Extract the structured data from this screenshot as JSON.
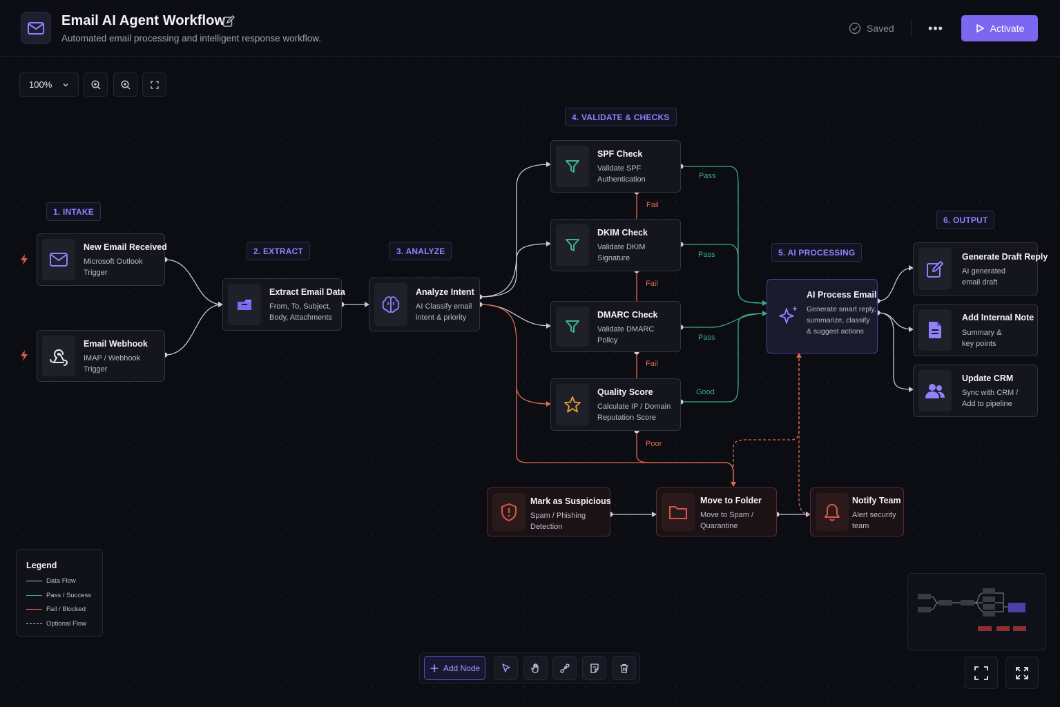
{
  "header": {
    "title": "Email AI Agent Workflow",
    "subtitle": "Automated email processing and intelligent response workflow.",
    "saved_label": "Saved",
    "more_label": "•••",
    "activate_label": "Activate"
  },
  "toolbar": {
    "zoom_value": "100%"
  },
  "sections": {
    "intake": "1. INTAKE",
    "extract": "2. EXTRACT",
    "analyze": "3. ANALYZE",
    "validate": "4. VALIDATE & CHECKS",
    "ai_processing": "5. AI PROCESSING",
    "output": "6. OUTPUT"
  },
  "nodes": {
    "new_email": {
      "title": "New Email Received",
      "desc": "Microsoft Outlook\nTrigger",
      "icon": "mail-icon"
    },
    "webhook": {
      "title": "Email Webhook",
      "desc": "IMAP / Webhook\nTrigger",
      "icon": "webhook-icon"
    },
    "extract": {
      "title": "Extract Email Data",
      "desc": "From, To, Subject,\nBody, Attachments",
      "icon": "box-icon"
    },
    "analyze": {
      "title": "Analyze Intent",
      "desc": "AI Classify email\nintent & priority",
      "icon": "brain-icon"
    },
    "spf": {
      "title": "SPF Check",
      "desc": "Validate SPF\nAuthentication",
      "icon": "filter-icon"
    },
    "dkim": {
      "title": "DKIM Check",
      "desc": "Validate DKIM\nSignature",
      "icon": "filter-icon"
    },
    "dmarc": {
      "title": "DMARC Check",
      "desc": "Validate DMARC\nPolicy",
      "icon": "filter-icon"
    },
    "quality": {
      "title": "Quality Score",
      "desc": "Calculate IP / Domain\nReputation Score",
      "icon": "star-icon"
    },
    "ai_process": {
      "title": "AI Process Email",
      "desc": "Generate smart reply,\nsummarize, classify\n& suggest actions",
      "icon": "sparkle-icon"
    },
    "draft_reply": {
      "title": "Generate Draft Reply",
      "desc": "AI generated\nemail draft",
      "icon": "pencil-icon"
    },
    "internal_note": {
      "title": "Add Internal Note",
      "desc": "Summary &\nkey points",
      "icon": "document-icon"
    },
    "update_crm": {
      "title": "Update CRM",
      "desc": "Sync with CRM /\nAdd to pipeline",
      "icon": "users-icon"
    },
    "mark_suspicious": {
      "title": "Mark as Suspicious",
      "desc": "Spam / Phishing\nDetection",
      "icon": "shield-alert-icon"
    },
    "move_folder": {
      "title": "Move to Folder",
      "desc": "Move to Spam /\nQuarantine",
      "icon": "folder-icon"
    },
    "notify_team": {
      "title": "Notify Team",
      "desc": "Alert security\nteam",
      "icon": "bell-icon"
    }
  },
  "edge_labels": {
    "spf_pass": "Pass",
    "spf_fail": "Fail",
    "dkim_pass": "Pass",
    "dkim_fail": "Fail",
    "dmarc_pass": "Pass",
    "dmarc_fail": "Fail",
    "quality_good": "Good",
    "quality_poor": "Poor"
  },
  "legend": {
    "title": "Legend",
    "items": [
      {
        "label": "Data Flow",
        "color": "#c9c9d6",
        "style": "solid"
      },
      {
        "label": "Pass / Success",
        "color": "#3fa889",
        "style": "solid"
      },
      {
        "label": "Fail / Blocked",
        "color": "#e06a4e",
        "style": "solid"
      },
      {
        "label": "Optional Flow",
        "color": "#c9c9d6",
        "style": "dashed"
      }
    ]
  },
  "bottom_toolbar": {
    "add_node_label": "Add Node",
    "tools": [
      "pointer-icon",
      "hand-icon",
      "connect-icon",
      "note-icon",
      "trash-icon"
    ]
  },
  "colors": {
    "accent": "#7c67f0",
    "pass": "#3fa889",
    "fail": "#e06a4e",
    "data_flow": "#c9c9d6"
  }
}
